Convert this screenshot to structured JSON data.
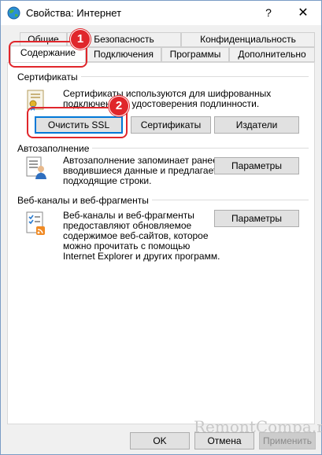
{
  "window": {
    "title": "Свойства: Интернет",
    "help_glyph": "?",
    "close_glyph": "✕"
  },
  "tabs": {
    "row_back": [
      {
        "label": "Общие"
      },
      {
        "label": "Безопасность"
      },
      {
        "label": "Конфиденциальность"
      }
    ],
    "row_front": [
      {
        "label": "Содержание",
        "active": true
      },
      {
        "label": "Подключения"
      },
      {
        "label": "Программы"
      },
      {
        "label": "Дополнительно"
      }
    ]
  },
  "certificates": {
    "group_label": "Сертификаты",
    "description_line1": "Сертификаты используются для шифрованных",
    "description_line2": "подключений и удостоверения подлинности.",
    "clear_ssl_label": "Очистить SSL",
    "certificates_label": "Сертификаты",
    "publishers_label": "Издатели"
  },
  "autocomplete": {
    "group_label": "Автозаполнение",
    "description_line1": "Автозаполнение запоминает ранее",
    "description_line2": "вводившиеся данные и предлагает",
    "description_line3": "подходящие строки.",
    "settings_label": "Параметры"
  },
  "feeds": {
    "group_label": "Веб-каналы и веб-фрагменты",
    "description_line1": "Веб-каналы и веб-фрагменты",
    "description_line2": "предоставляют обновляемое",
    "description_line3": "содержимое веб-сайтов, которое",
    "description_line4": "можно прочитать с помощью",
    "description_line5": "Internet Explorer и других программ.",
    "settings_label": "Параметры"
  },
  "footer": {
    "ok_label": "OK",
    "cancel_label": "Отмена",
    "apply_label": "Применить"
  },
  "annotations": {
    "badge1": "1",
    "badge2": "2",
    "accent_color": "#e0262b"
  },
  "watermark": "RemontCompa.ru",
  "colors": {
    "focus_blue": "#0078d7",
    "panel_white": "#ffffff",
    "dialog_gray": "#f0f0f0"
  }
}
